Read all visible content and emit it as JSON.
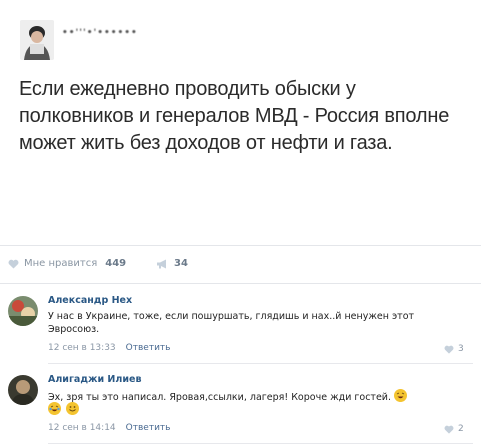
{
  "post": {
    "author": "••'''•'••••••",
    "text": "Если ежедневно проводить обыски у полковников и генералов МВД - Россия вполне может жить без доходов от нефти и газа."
  },
  "stats": {
    "likes_label": "Мне нравится",
    "likes_count": "449",
    "reposts_count": "34"
  },
  "comments": [
    {
      "name": "Александр Нех",
      "text": "У нас в Украине, тоже, если пошуршать, глядишь и нах..й ненужен этот Эвросоюз.",
      "date": "12 сен в 13:33",
      "reply_label": "Ответить",
      "likes": "3"
    },
    {
      "name": "Алигаджи Илиев",
      "text": "Эх, зря ты это написал. Яровая,ссылки, лагеря! Короче жди гостей.",
      "date": "12 сен в 14:14",
      "reply_label": "Ответить",
      "likes": "2",
      "emojis": [
        "laughing-emoji",
        "grinning-emoji",
        "laughing-emoji"
      ]
    }
  ],
  "colors": {
    "link": "#2a5885",
    "meta": "#8b97a6",
    "divider": "#e4e6ea"
  }
}
